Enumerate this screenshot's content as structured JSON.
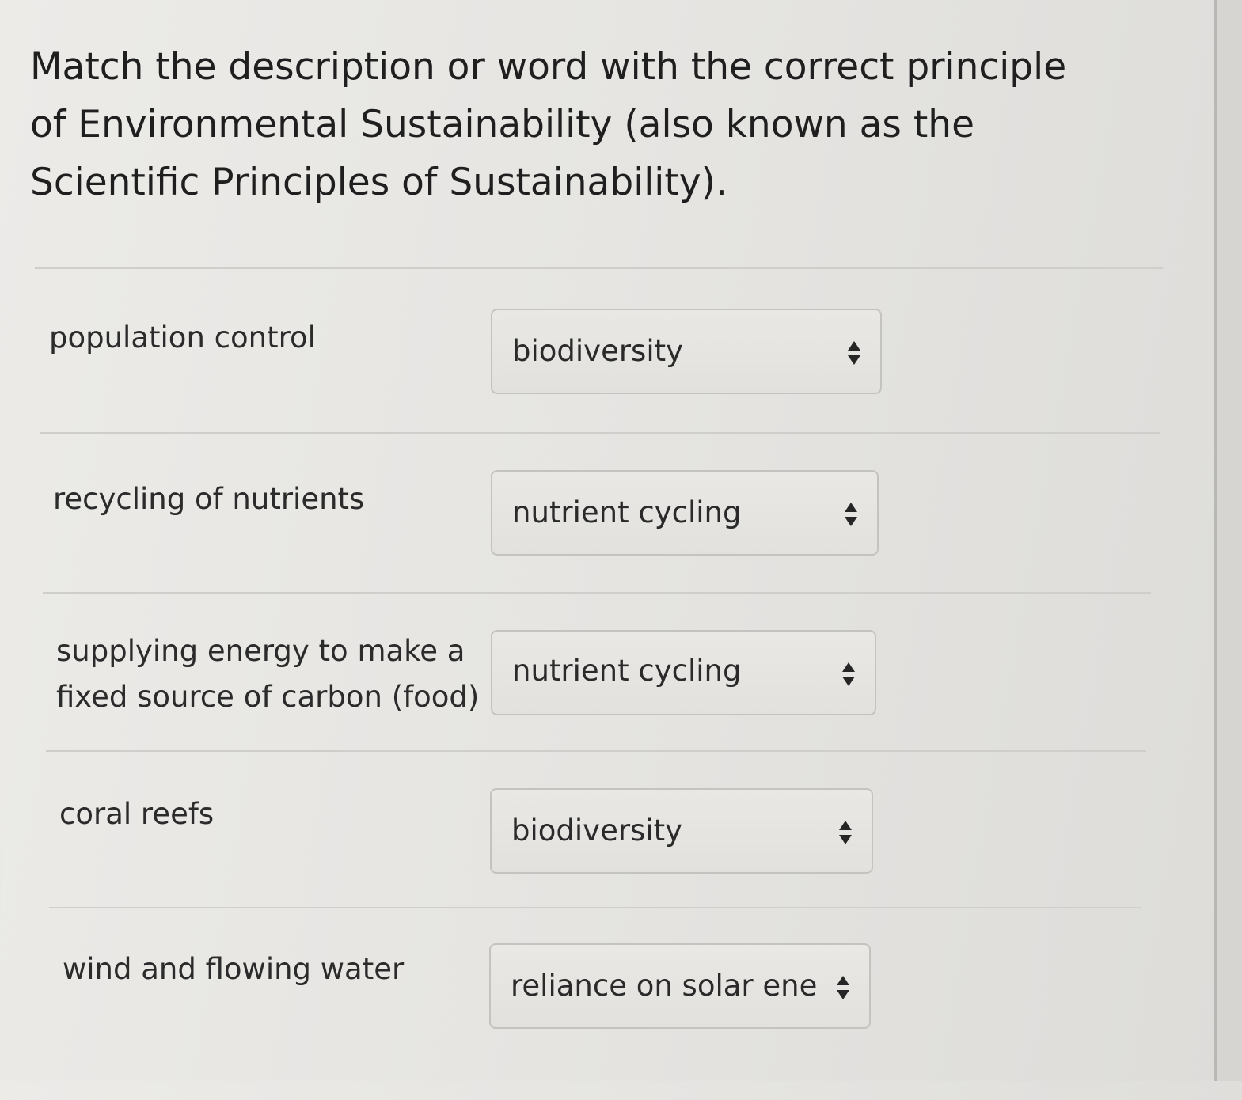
{
  "question": {
    "text": "Match the description or word with the correct principle of Environmental Sustainability (also known as the Scientific Principles of Sustainability)."
  },
  "rows": [
    {
      "label": "population control",
      "selected": "biodiversity"
    },
    {
      "label": "recycling of nutrients",
      "selected": "nutrient cycling"
    },
    {
      "label": "supplying energy to make a fixed source of carbon (food)",
      "selected": "nutrient cycling"
    },
    {
      "label": "coral reefs",
      "selected": "biodiversity"
    },
    {
      "label": "wind and flowing water",
      "selected": "reliance on solar energy"
    }
  ],
  "icons": {
    "select_arrows": "up-down-arrows-icon"
  },
  "colors": {
    "background": "#e6e5e2",
    "select_fill": "#e5e4e1",
    "select_border": "#c4c3c0",
    "text": "#2a2a2a"
  }
}
